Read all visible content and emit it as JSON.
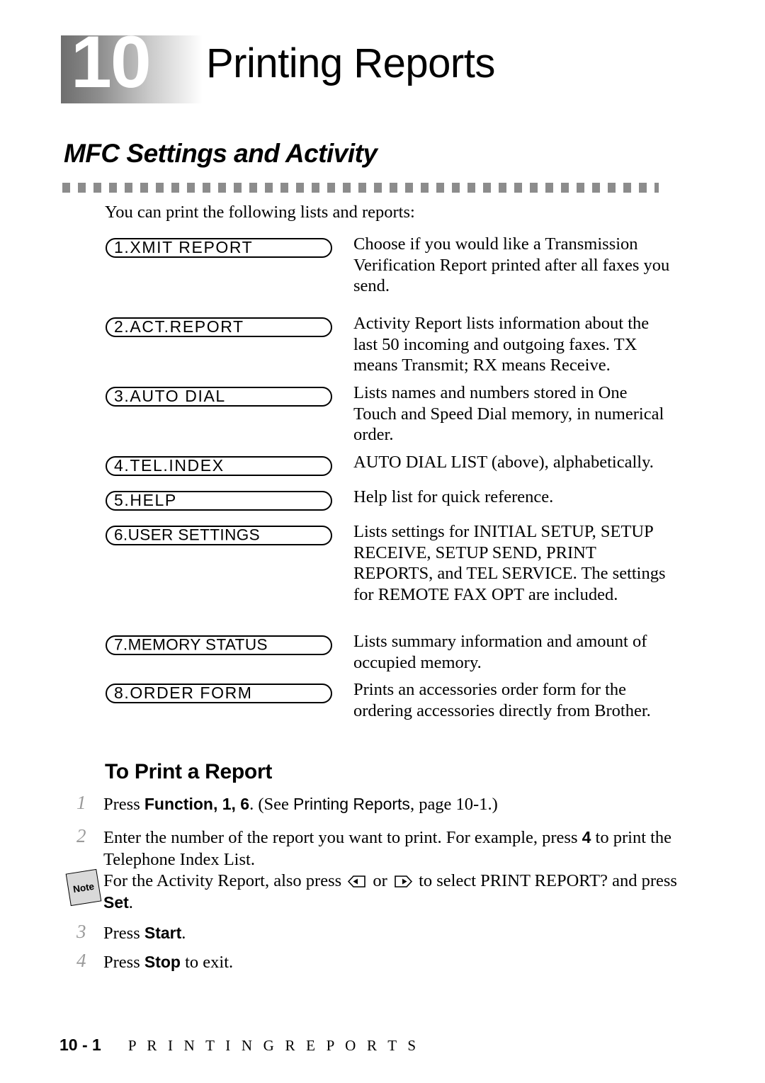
{
  "chapter": {
    "number": "10",
    "title": "Printing Reports"
  },
  "section": {
    "heading": "MFC Settings and Activity",
    "intro": "You can print the following lists and reports:"
  },
  "reports": [
    {
      "lcd": "1.XMIT REPORT",
      "description": "Choose if you would like a Transmission Verification Report printed after all faxes you send."
    },
    {
      "lcd": "2.ACT.REPORT",
      "description": "Activity Report lists information about the last 50 incoming and outgoing faxes. TX means Transmit; RX means Receive."
    },
    {
      "lcd": "3.AUTO DIAL",
      "description": "Lists names and numbers stored in One Touch and Speed Dial memory, in numerical order."
    },
    {
      "lcd": "4.TEL.INDEX",
      "description": "AUTO DIAL LIST (above), alphabetically."
    },
    {
      "lcd": "5.HELP",
      "description": "Help list for quick reference."
    },
    {
      "lcd": "6.USER SETTINGS",
      "description": "Lists settings for INITIAL SETUP, SETUP RECEIVE, SETUP SEND, PRINT REPORTS, and TEL SERVICE. The settings for REMOTE FAX OPT are included."
    },
    {
      "lcd": "7.MEMORY STATUS",
      "description": "Lists summary information and amount of occupied memory."
    },
    {
      "lcd": "8.ORDER FORM",
      "description": "Prints an accessories order form for the ordering accessories directly from Brother."
    }
  ],
  "procedure": {
    "heading": "To Print a Report",
    "step1": {
      "number": "1",
      "press_label": "Press ",
      "keys": "Function, 1, 6",
      "after_keys": ". (See ",
      "reference": "Printing Reports",
      "reference_tail": ", page 10-1.)"
    },
    "step2": {
      "number": "2",
      "text_before": "Enter the number of the report you want to print.  For example, press ",
      "key": "4",
      "text_after": " to print the Telephone Index List."
    },
    "note": {
      "icon_label": "Note",
      "text_before": "For the Activity Report, also press ",
      "left_key_icon": "left-arrow-key-icon",
      "between_keys": " or ",
      "right_key_icon": "right-arrow-key-icon",
      "text_middle": " to select PRINT REPORT? and press ",
      "set_key": "Set",
      "text_after": "."
    },
    "step3": {
      "number": "3",
      "text_before": "Press ",
      "key": "Start",
      "text_after": "."
    },
    "step4": {
      "number": "4",
      "text_before": "Press ",
      "key": "Stop",
      "text_after": " to exit."
    }
  },
  "footer": {
    "page": "10 - 1",
    "title": "P R I N T I N G   R E P O R T S"
  },
  "colors": {
    "rule": "#8c8c8c",
    "step_number": "#9a9a9a",
    "note_icon_fill": "#d9d9d9",
    "badge_gradient_start": "#6e6e6e",
    "badge_gradient_end": "#ffffff"
  }
}
